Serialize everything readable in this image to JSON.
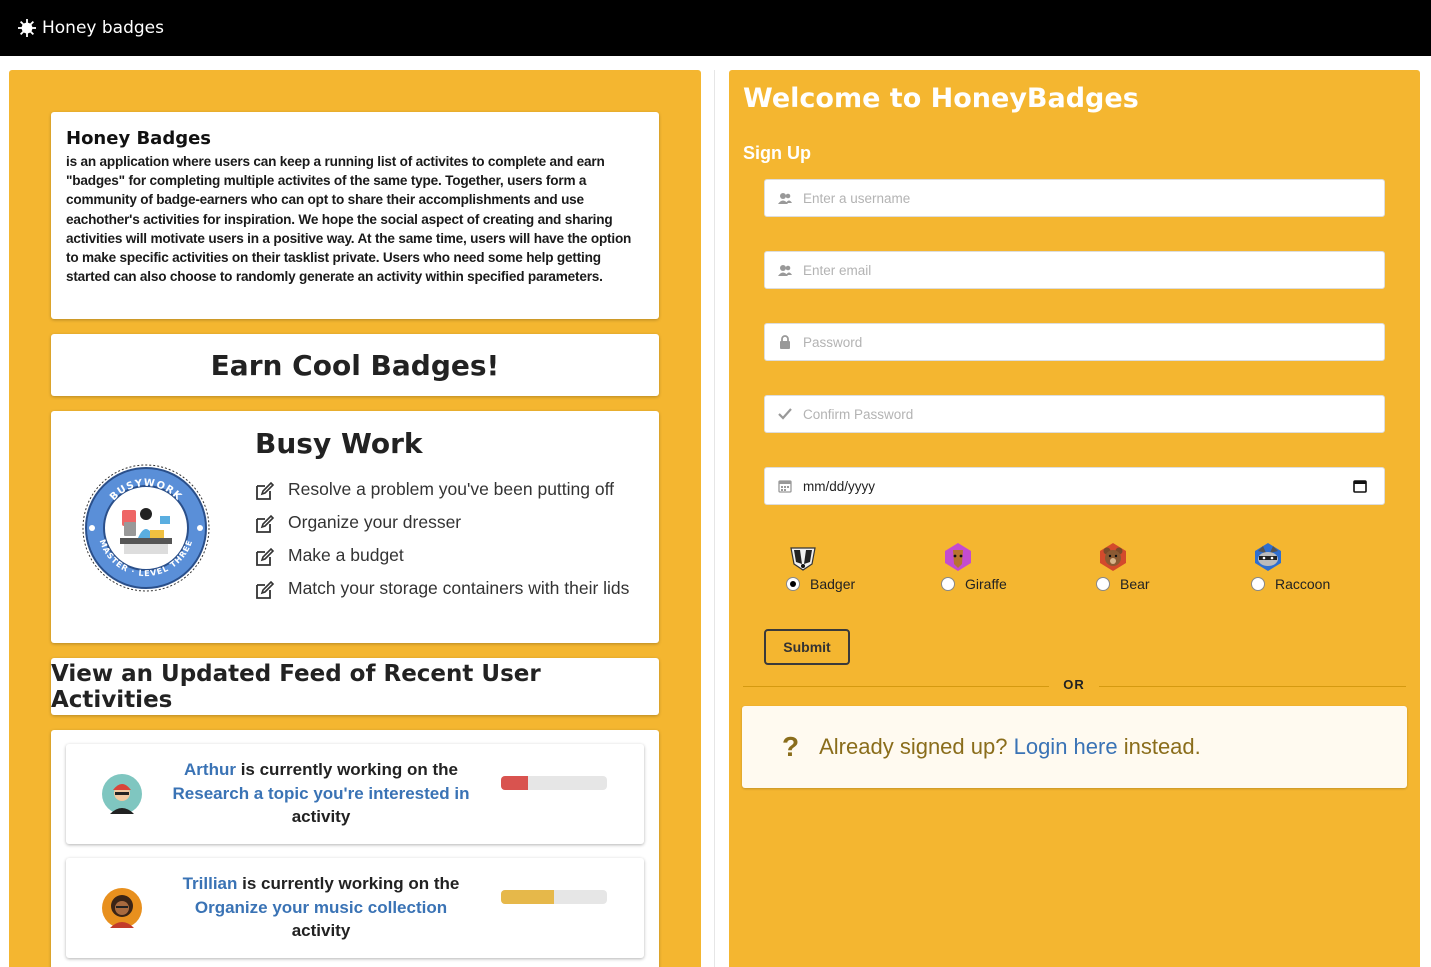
{
  "topbar": {
    "brand": "Honey badges",
    "logo_icon": "gear-icon"
  },
  "about": {
    "title": "Honey Badges",
    "description": "is an application where users can keep a running list of activites to complete and earn \"badges\" for completing multiple activites of the same type. Together, users form a community of badge-earners who can opt to share their accomplishments and use eachother's activities for inspiration. We hope the social aspect of creating and sharing activities will motivate users in a positive way. At the same time, users will have the option to make specific activities on their tasklist private. Users who need some help getting started can also choose to randomly generate an activity within specified parameters."
  },
  "earn": {
    "title": "Earn Cool Badges!"
  },
  "busy": {
    "title": "Busy Work",
    "badge_top_text": "BUSYWORK",
    "badge_bottom_text": "MASTER · LEVEL THREE",
    "items": [
      "Resolve a problem you've been putting off",
      "Organize your dresser",
      "Make a budget",
      "Match your storage containers with their lids"
    ]
  },
  "feed": {
    "title": "View an Updated Feed of Recent User Activities",
    "items": [
      {
        "user": "Arthur",
        "mid": "is currently working on the",
        "activity": "Research a topic you're interested in",
        "suffix": "activity",
        "progress": 0.25,
        "color": "#d9534f"
      },
      {
        "user": "Trillian",
        "mid": "is currently working on the",
        "activity": "Organize your music collection",
        "suffix": "activity",
        "progress": 0.5,
        "color": "#e6b84a"
      }
    ]
  },
  "signup": {
    "welcome": "Welcome to HoneyBadges",
    "heading": "Sign Up",
    "username_placeholder": "Enter a username",
    "email_placeholder": "Enter email",
    "password_placeholder": "Password",
    "confirm_placeholder": "Confirm Password",
    "date_value": "mm/dd/yyyy",
    "animals": [
      {
        "label": "Badger",
        "selected": true
      },
      {
        "label": "Giraffe",
        "selected": false
      },
      {
        "label": "Bear",
        "selected": false
      },
      {
        "label": "Raccoon",
        "selected": false
      }
    ],
    "submit_label": "Submit",
    "or_label": "OR",
    "already_prefix": "Already signed up?",
    "login_link": "Login here",
    "already_suffix": "instead."
  }
}
